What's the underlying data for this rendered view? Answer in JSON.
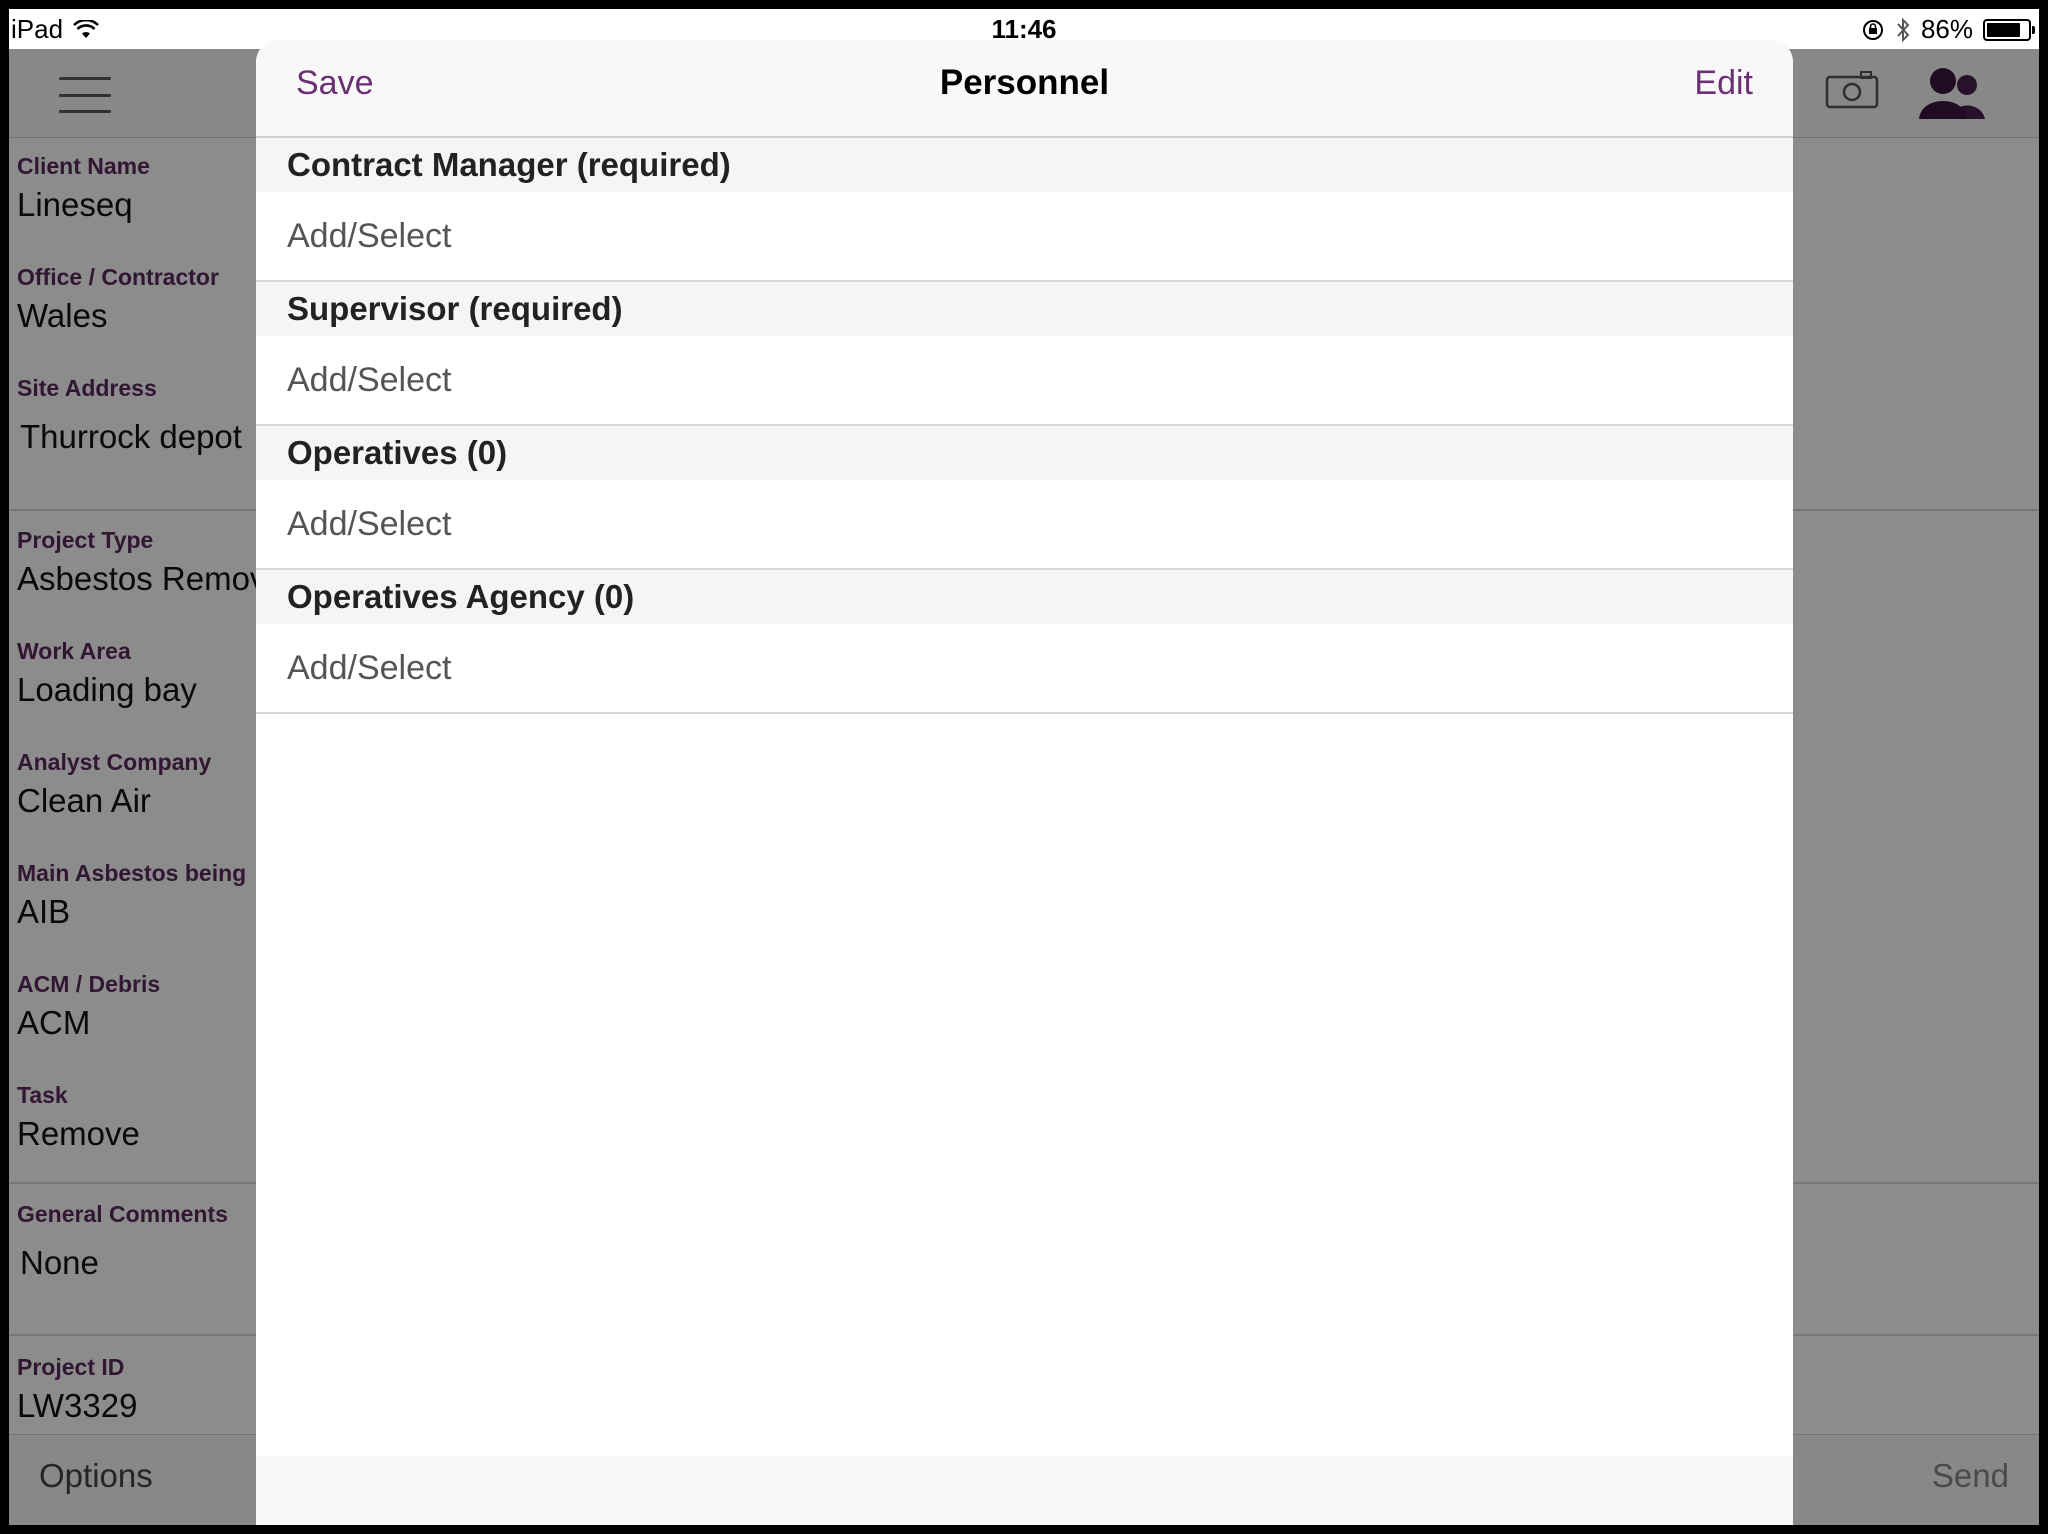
{
  "status_bar": {
    "device": "iPad",
    "time": "11:46",
    "battery": "86%",
    "battery_level": 0.86
  },
  "form": {
    "fields": [
      {
        "label": "Client Name",
        "value": "Lineseq"
      },
      {
        "label": "Office / Contractor",
        "value": "Wales"
      },
      {
        "label": "Site Address",
        "value": "Thurrock depot"
      },
      {
        "label": "Project Type",
        "value": "Asbestos Remov"
      },
      {
        "label": "Work Area",
        "value": "Loading bay"
      },
      {
        "label": "Analyst Company",
        "value": "Clean Air"
      },
      {
        "label": "Main Asbestos being",
        "value": "AIB"
      },
      {
        "label": "ACM / Debris",
        "value": "ACM"
      },
      {
        "label": "Task",
        "value": "Remove"
      },
      {
        "label": "General Comments",
        "value": "None"
      },
      {
        "label": "Project ID",
        "value": "LW3329"
      }
    ]
  },
  "toolbar": {
    "options_label": "Options",
    "send_label": "Send"
  },
  "modal": {
    "title": "Personnel",
    "save_label": "Save",
    "edit_label": "Edit",
    "sections": [
      {
        "header": "Contract Manager (required)",
        "row": "Add/Select"
      },
      {
        "header": "Supervisor (required)",
        "row": "Add/Select"
      },
      {
        "header": "Operatives (0)",
        "row": "Add/Select"
      },
      {
        "header": "Operatives Agency (0)",
        "row": "Add/Select"
      }
    ]
  },
  "colors": {
    "accent": "#6b2f74",
    "label": "#5b2a5e"
  }
}
